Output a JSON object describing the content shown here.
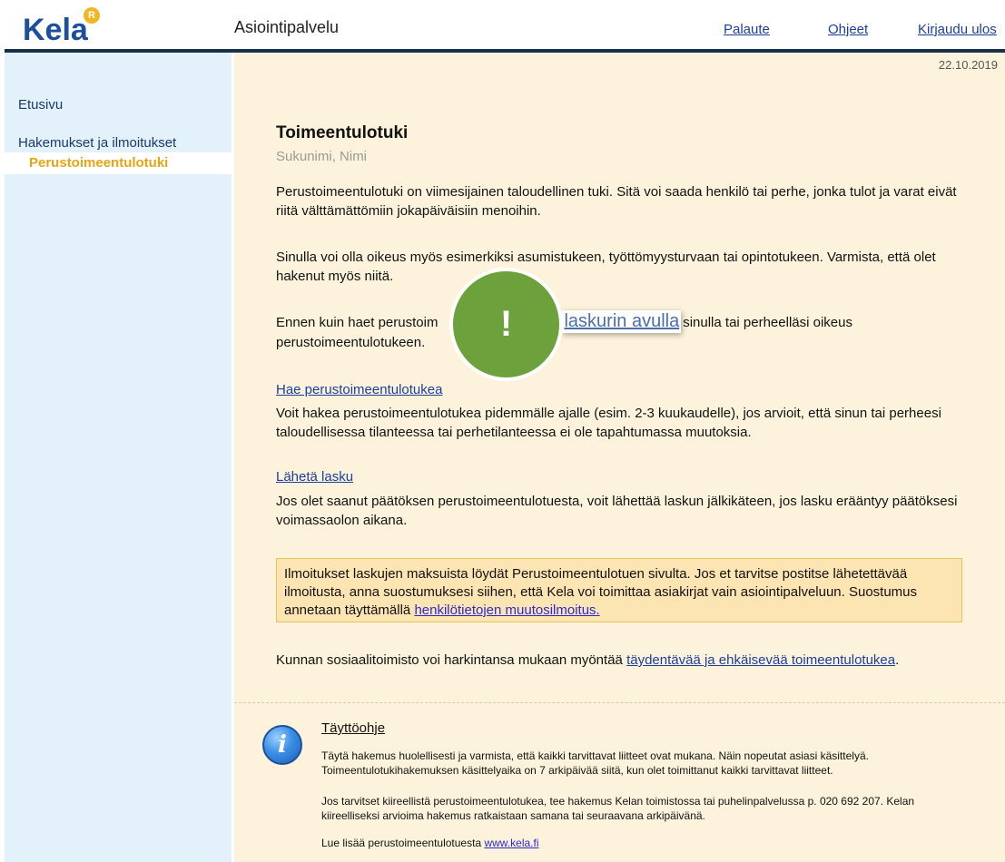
{
  "header": {
    "logo_text": "Kela",
    "logo_badge": "R",
    "app_title": "Asiointipalvelu",
    "links": {
      "feedback": "Palaute",
      "help": "Ohjeet",
      "logout": "Kirjaudu ulos"
    }
  },
  "sidebar": {
    "home": "Etusivu",
    "section": "Hakemukset ja ilmoitukset",
    "active_item": "Perustoimeentulotuki"
  },
  "main": {
    "date": "22.10.2019",
    "title": "Toimeentulotuki",
    "subtitle": "Sukunimi, Nimi",
    "para1": "Perustoimeentulotuki on viimesijainen taloudellinen tuki. Sitä voi saada henkilö tai perhe, jonka tulot ja varat eivät riitä välttämättömiin jokapäiväisiin menoihin.",
    "para2": "Sinulla voi olla oikeus myös esimerkiksi asumistukeen, työttömyysturvaan tai opintotukeen. Varmista, että olet hakenut myös niitä.",
    "para3_start": "Ennen kuin haet perustoim",
    "para3_mid": "ioi",
    "para3_link": "laskurin avulla",
    "para3_end": "sinulla tai perheelläsi oikeus perustoimeentulotukeen.",
    "apply_link": "Hae perustoimeentulotukea",
    "apply_text": "Voit hakea perustoimeentulotukea pidemmälle ajalle (esim. 2-3 kuukaudelle), jos arvioit, että sinun tai perheesi taloudellisessa tilanteessa tai perhetilanteessa ei ole tapahtumassa muutoksia.",
    "invoice_link": "Lähetä lasku",
    "invoice_text": "Jos olet saanut päätöksen perustoimeentulotuesta, voit lähettää laskun jälkikäteen, jos lasku erääntyy päätöksesi voimassaolon aikana.",
    "notice_text": "Ilmoitukset laskujen maksuista löydät  Perustoimeentulotuen sivulta.  Jos et tarvitse postitse lähetettävää ilmoitusta, anna suostumuksesi siihen, että Kela voi toimittaa asiakirjat vain asiointipalveluun. Suostumus annetaan täyttämällä",
    "notice_link": "henkilötietojen muutosilmoitus.",
    "municipal_text": "Kunnan sosiaalitoimisto voi harkintansa mukaan myöntää",
    "municipal_link": "täydentävää ja ehkäisevää toimeentulotukea",
    "municipal_end": ".",
    "badge_symbol": "!"
  },
  "guide": {
    "icon": "info-icon",
    "title": "Täyttöohje",
    "p1": "Täytä hakemus huolellisesti ja varmista, että kaikki tarvittavat liitteet ovat mukana. Näin nopeutat asiasi käsittelyä. Toimeentulotukihakemuksen käsittelyaika on 7 arkipäivää siitä, kun olet toimittanut kaikki tarvittavat liitteet.",
    "p2": "Jos tarvitset kiireellistä perustoimeentulotukea, tee hakemus Kelan toimistossa tai puhelinpalvelussa p. 020 692 207. Kelan kiireelliseksi arvioima hakemus ratkaistaan samana tai seuraavana arkipäivänä.",
    "p3_text": "Lue lisää perustoimeentulotuesta",
    "p3_link": "www.kela.fi"
  }
}
